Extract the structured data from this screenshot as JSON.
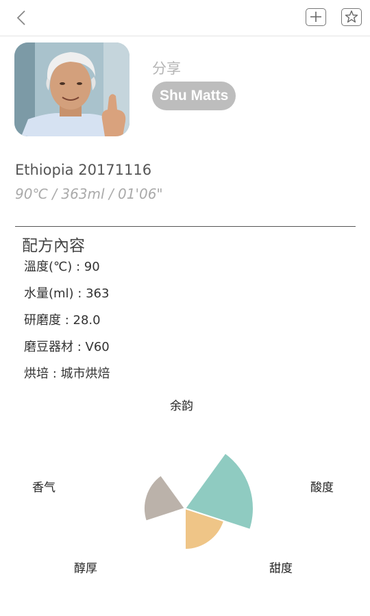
{
  "header": {
    "back_icon": "chevron-left-icon",
    "add_icon": "plus-box-icon",
    "favorite_icon": "star-box-icon"
  },
  "profile": {
    "share_label": "分享",
    "user_name": "Shu Matts"
  },
  "brew": {
    "bean_name": "Ethiopia 20171116",
    "summary": "90℃ / 363ml / 01'06\""
  },
  "recipe": {
    "section_title": "配方內容",
    "items": [
      "溫度(℃) : 90",
      "水量(ml) : 363",
      "研磨度 : 28.0",
      "磨豆器材 : V60",
      "烘培 : 城市烘焙"
    ]
  },
  "chart_data": {
    "type": "pie",
    "subtype": "polar-area",
    "axes": [
      "余韵",
      "酸度",
      "甜度",
      "醇厚",
      "香气"
    ],
    "values": [
      0,
      5,
      3,
      0,
      3
    ],
    "max": 5,
    "colors": [
      "#8fcbc1",
      "#8fcbc1",
      "#efc587",
      "#bbb2aa",
      "#bbb2aa"
    ]
  }
}
